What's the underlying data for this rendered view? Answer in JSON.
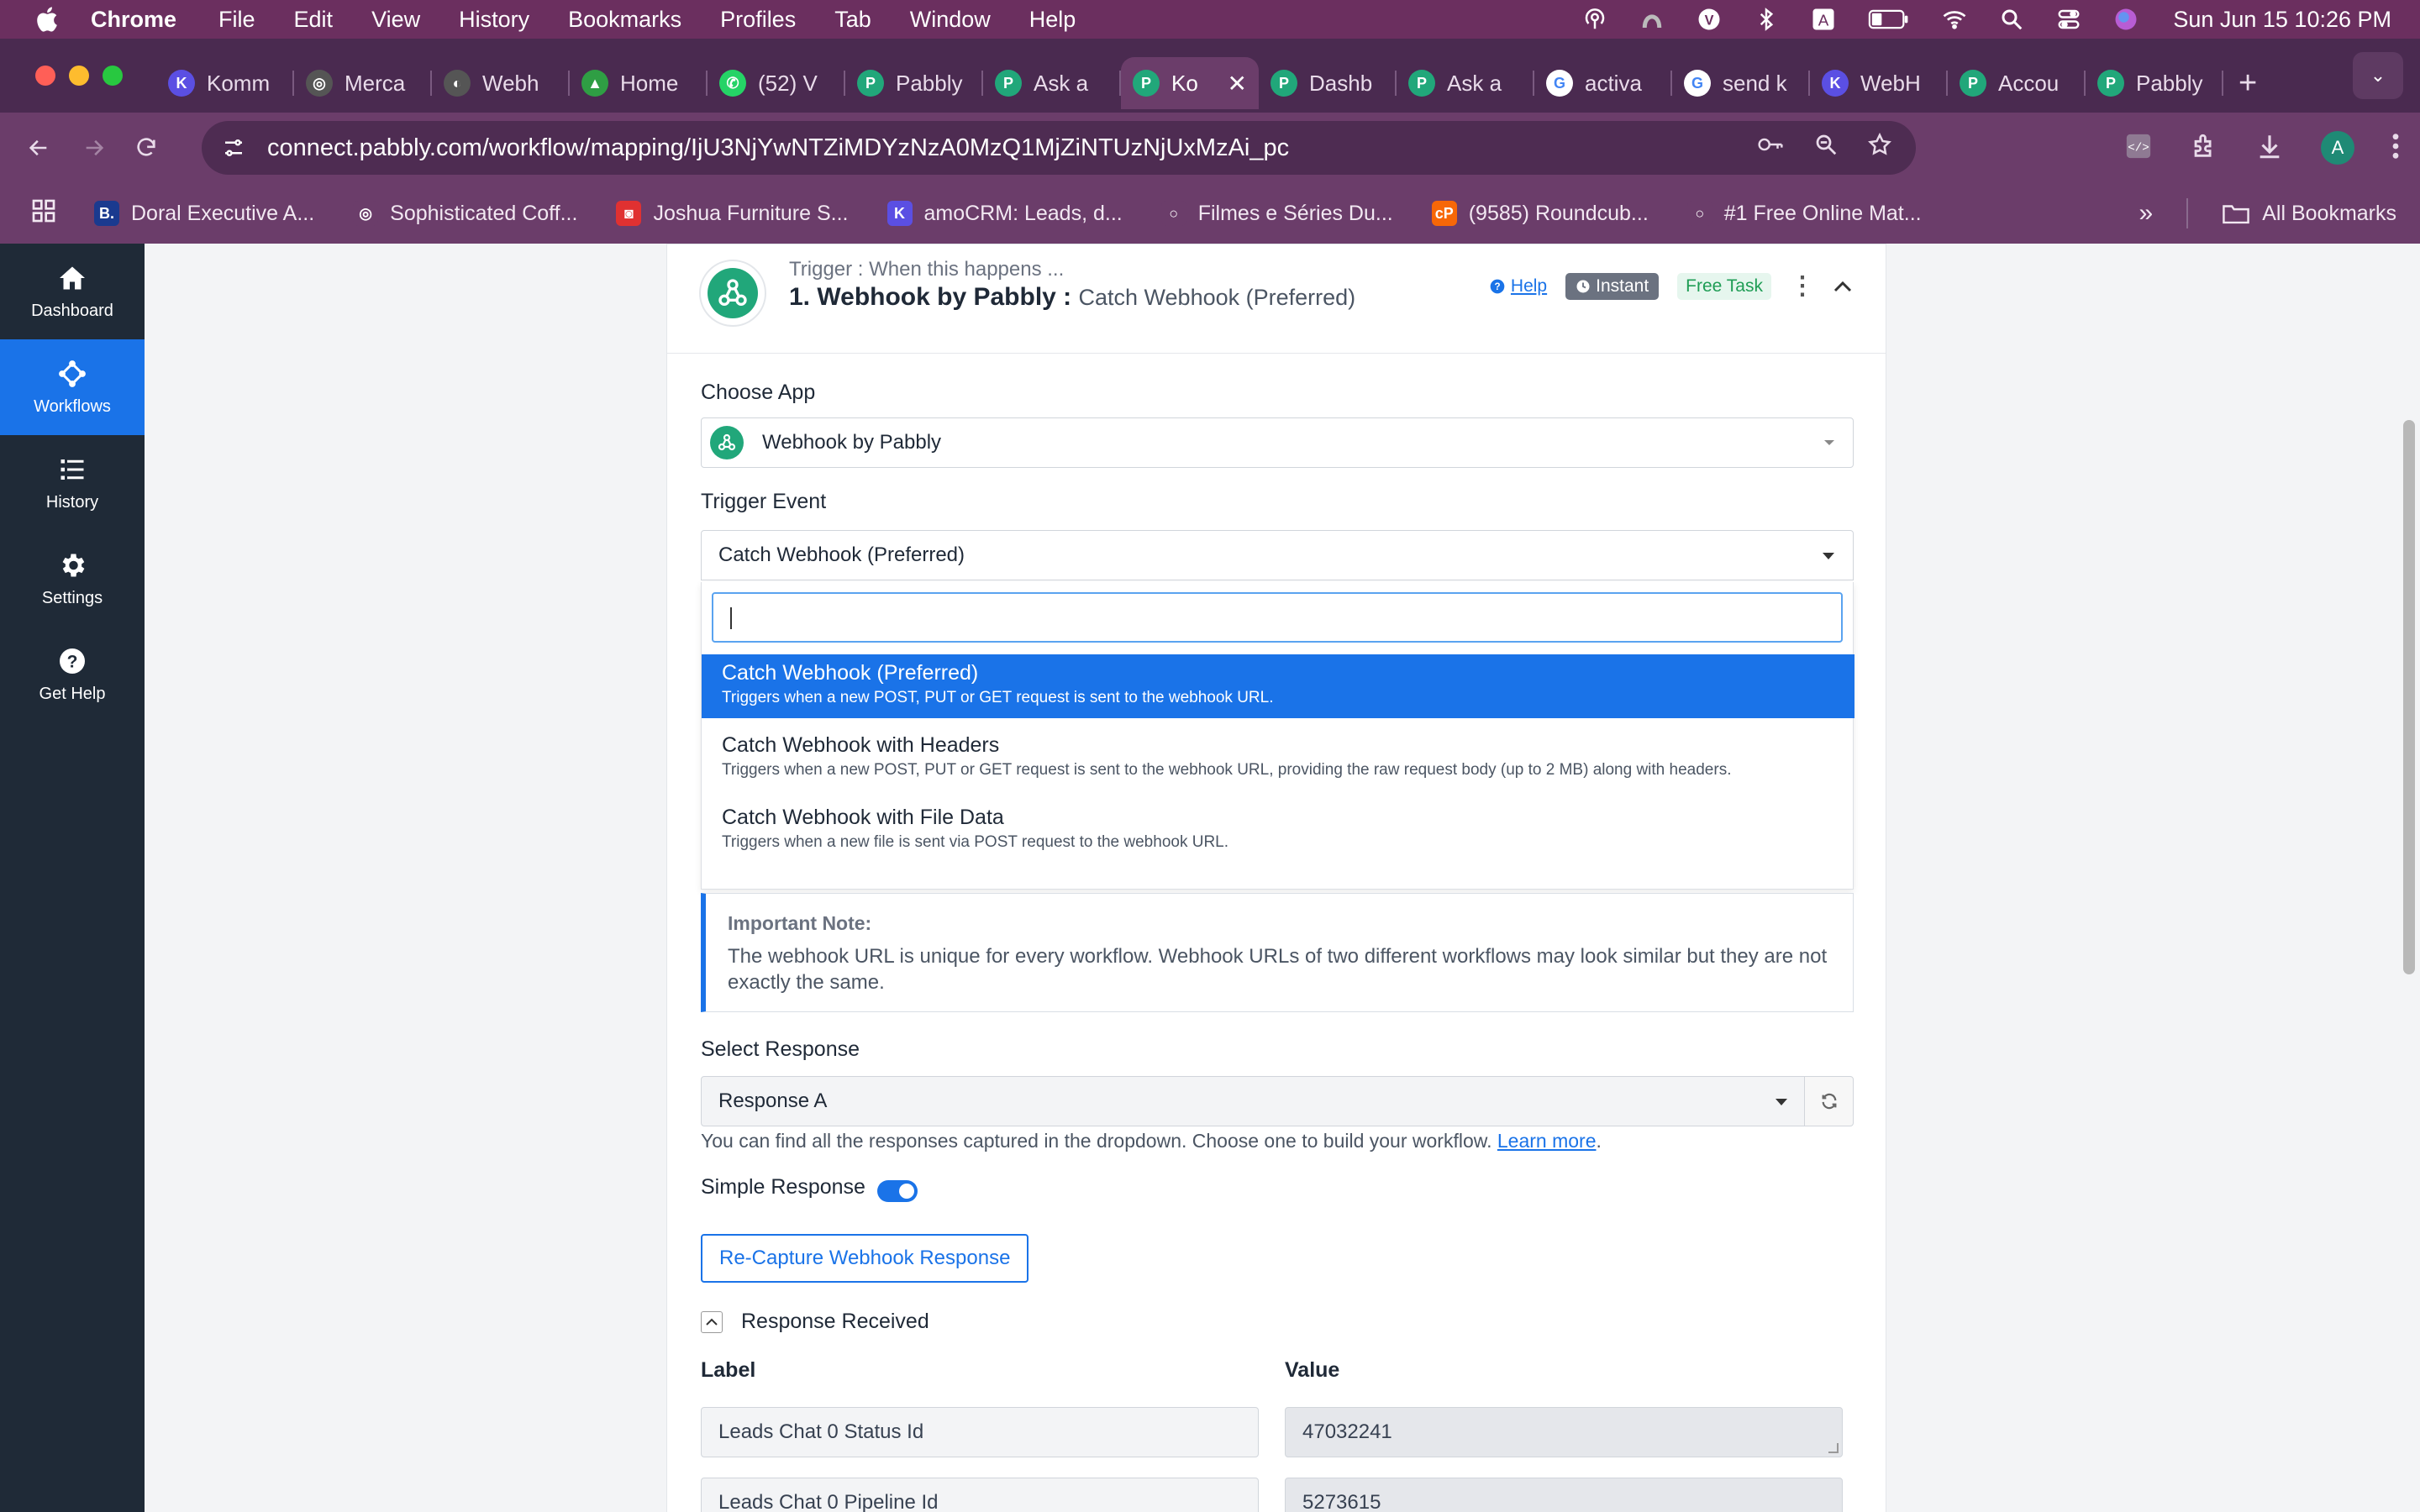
{
  "menubar": {
    "app": "Chrome",
    "items": [
      "File",
      "Edit",
      "View",
      "History",
      "Bookmarks",
      "Profiles",
      "Tab",
      "Window",
      "Help"
    ],
    "clock": "Sun Jun 15  10:26 PM",
    "status_icons": [
      "podcast-icon",
      "arc-icon",
      "vpn-icon",
      "bluetooth-icon",
      "text-input-icon",
      "battery-icon",
      "wifi-icon",
      "search-icon",
      "control-center-icon",
      "siri-icon"
    ]
  },
  "tabs": [
    {
      "title": "Komm",
      "icon": "kommo-icon",
      "color": "#5b4fe3",
      "letter": "K"
    },
    {
      "title": "Merca",
      "icon": "openai-icon",
      "color": "#555555",
      "letter": "◎"
    },
    {
      "title": "Webh",
      "icon": "webhook-icon",
      "color": "#555555",
      "letter": "◐"
    },
    {
      "title": "Home",
      "icon": "google-drive-icon",
      "color": "#2f9e44",
      "letter": "▲"
    },
    {
      "title": "(52) V",
      "icon": "whatsapp-icon",
      "color": "#25d366",
      "letter": "✆"
    },
    {
      "title": "Pabbly",
      "icon": "pabbly-icon",
      "color": "#21a77a",
      "letter": "P"
    },
    {
      "title": "Ask a",
      "icon": "pabbly-icon",
      "color": "#21a77a",
      "letter": "P"
    },
    {
      "title": "Ko",
      "icon": "pabbly-icon",
      "color": "#21a77a",
      "letter": "P",
      "active": true
    },
    {
      "title": "Dashb",
      "icon": "pabbly-icon",
      "color": "#21a77a",
      "letter": "P"
    },
    {
      "title": "Ask a",
      "icon": "pabbly-icon",
      "color": "#21a77a",
      "letter": "P"
    },
    {
      "title": "activa",
      "icon": "google-icon",
      "color": "#ffffff",
      "letter": "G"
    },
    {
      "title": "send k",
      "icon": "google-icon",
      "color": "#ffffff",
      "letter": "G"
    },
    {
      "title": "WebH",
      "icon": "kommo-icon",
      "color": "#5b4fe3",
      "letter": "K"
    },
    {
      "title": "Accou",
      "icon": "pabbly-icon",
      "color": "#21a77a",
      "letter": "P"
    },
    {
      "title": "Pabbly",
      "icon": "pabbly-icon",
      "color": "#21a77a",
      "letter": "P"
    }
  ],
  "toolbar": {
    "url": "connect.pabbly.com/workflow/mapping/IjU3NjYwNTZiMDYzNzA0MzQ1MjZiNTUzNjUxMzAi_pc",
    "avatar_letter": "A"
  },
  "bookmarks": {
    "items": [
      {
        "label": "Doral Executive A...",
        "icon": "booking-icon",
        "color": "#1a3a8f",
        "letter": "B."
      },
      {
        "label": "Sophisticated Coff...",
        "icon": "openai-icon",
        "color": "#6b3d6a",
        "letter": "◎"
      },
      {
        "label": "Joshua Furniture S...",
        "icon": "shop-icon",
        "color": "#e03131",
        "letter": "◙"
      },
      {
        "label": "amoCRM: Leads, d...",
        "icon": "kommo-icon",
        "color": "#5b4fe3",
        "letter": "K"
      },
      {
        "label": "Filmes e Séries Du...",
        "icon": "globe-icon",
        "color": "#6b3d6a",
        "letter": "○"
      },
      {
        "label": "(9585) Roundcub...",
        "icon": "cpanel-icon",
        "color": "#f76707",
        "letter": "cP"
      },
      {
        "label": "#1 Free Online Mat...",
        "icon": "globe-icon",
        "color": "#6b3d6a",
        "letter": "○"
      }
    ],
    "all_label": "All Bookmarks"
  },
  "sidebar": {
    "items": [
      {
        "label": "Dashboard",
        "icon": "home-icon"
      },
      {
        "label": "Workflows",
        "icon": "workflow-icon",
        "active": true
      },
      {
        "label": "History",
        "icon": "list-icon"
      },
      {
        "label": "Settings",
        "icon": "gear-icon"
      },
      {
        "label": "Get Help",
        "icon": "question-icon"
      }
    ]
  },
  "trigger": {
    "subtitle": "Trigger : When this happens ...",
    "title": "1. Webhook by Pabbly :",
    "event": "Catch Webhook (Preferred)",
    "help_label": "Help",
    "instant_label": "Instant",
    "free_task_label": "Free Task"
  },
  "form": {
    "choose_app_label": "Choose App",
    "choose_app_value": "Webhook by Pabbly",
    "trigger_event_label": "Trigger Event",
    "trigger_event_value": "Catch Webhook (Preferred)",
    "search_value": ""
  },
  "dropdown": {
    "options": [
      {
        "title": "Catch Webhook (Preferred)",
        "desc": "Triggers when a new POST, PUT or GET request is sent to the webhook URL.",
        "selected": true
      },
      {
        "title": "Catch Webhook with Headers",
        "desc": "Triggers when a new POST, PUT or GET request is sent to the webhook URL, providing the raw request body (up to 2 MB) along with headers."
      },
      {
        "title": "Catch Webhook with File Data",
        "desc": "Triggers when a new file is sent via POST request to the webhook URL."
      }
    ]
  },
  "note": {
    "title": "Important Note:",
    "body": "The webhook URL is unique for every workflow. Webhook URLs of two different workflows may look similar but they are not exactly the same."
  },
  "response": {
    "label": "Select Response",
    "value": "Response A",
    "hint": "You can find all the responses captured in the dropdown. Choose one to build your workflow.",
    "learn_more": "Learn more",
    "simple_response_label": "Simple Response",
    "simple_response_on": true,
    "recapture_label": "Re-Capture Webhook Response",
    "received_label": "Response Received",
    "col_label": "Label",
    "col_value": "Value",
    "rows": [
      {
        "label": "Leads Chat 0 Status Id",
        "value": "47032241"
      },
      {
        "label": "Leads Chat 0 Pipeline Id",
        "value": "5273615"
      }
    ]
  }
}
